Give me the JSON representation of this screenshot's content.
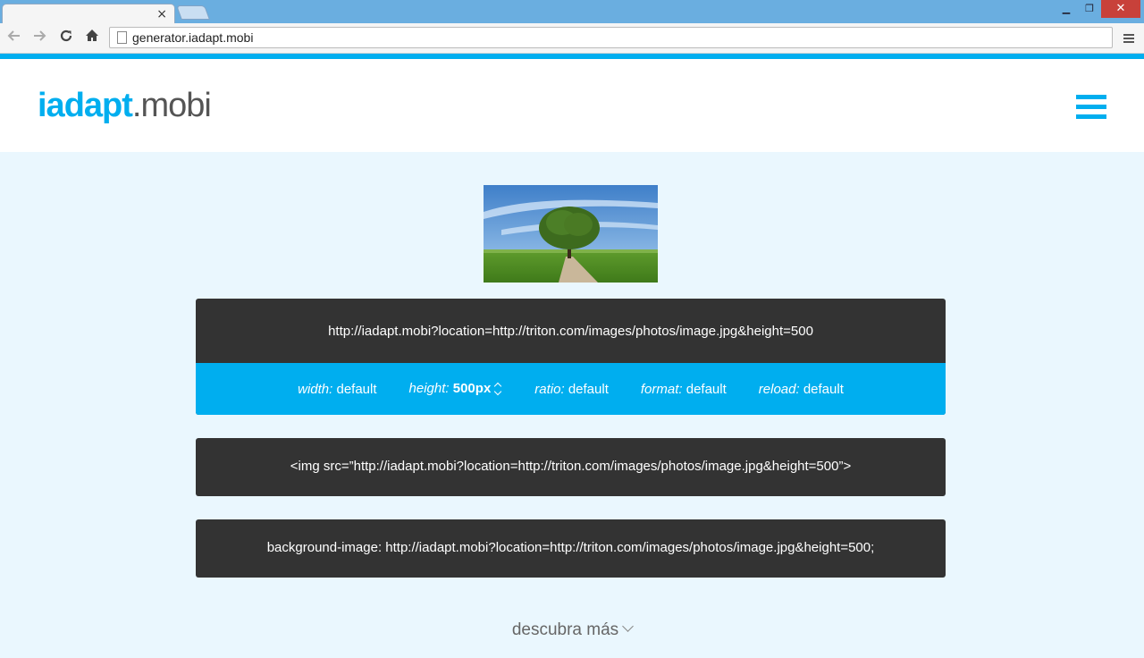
{
  "browser": {
    "tab_close_glyph": "×",
    "url": "generator.iadapt.mobi",
    "window_controls": {
      "minimize": "▁",
      "maximize": "❐",
      "close": "✕"
    }
  },
  "site": {
    "logo_primary": "iadapt",
    "logo_secondary": ".mobi",
    "menu_icon": "hamburger-menu-icon",
    "accent_color": "#00aeef"
  },
  "generator": {
    "url_output": "http://iadapt.mobi?location=http://triton.com/images/photos/image.jpg&height=500",
    "params": [
      {
        "key": "width:",
        "value": "default"
      },
      {
        "key": "height:",
        "value": "500px"
      },
      {
        "key": "ratio:",
        "value": "default"
      },
      {
        "key": "format:",
        "value": "default"
      },
      {
        "key": "reload:",
        "value": "default"
      }
    ],
    "img_tag": "<img src=”http://iadapt.mobi?location=http://triton.com/images/photos/image.jpg&height=500”>",
    "css_background": "background-image: http://iadapt.mobi?location=http://triton.com/images/photos/image.jpg&height=500;"
  },
  "footer": {
    "more_label": "descubra más"
  }
}
